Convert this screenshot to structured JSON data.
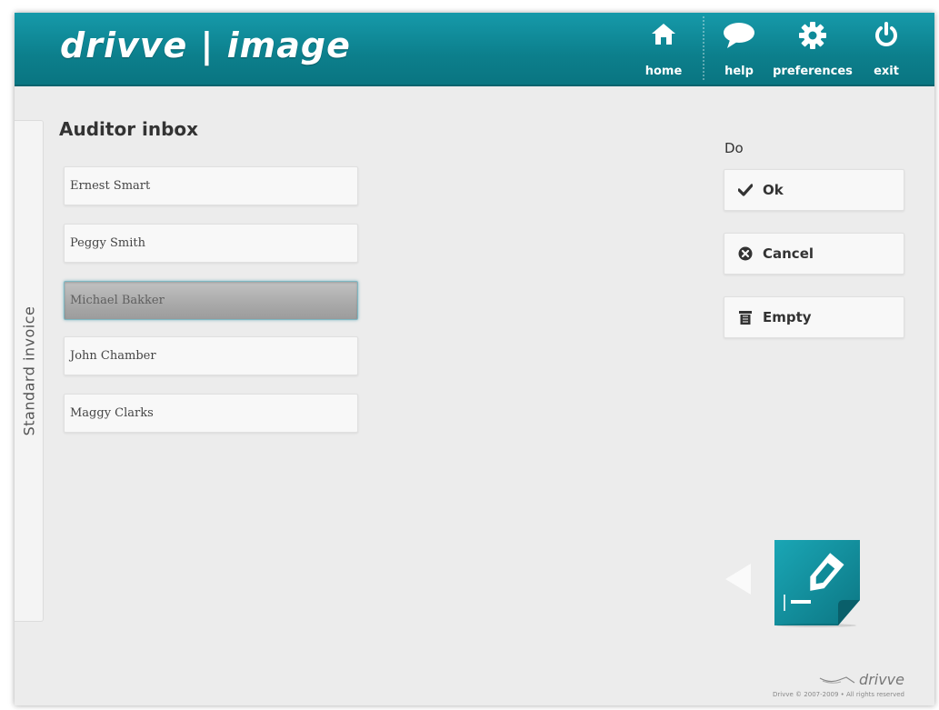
{
  "header": {
    "logo": "drivve | image",
    "nav": [
      {
        "label": "home",
        "icon": "home-icon"
      },
      {
        "label": "help",
        "icon": "speech-bubble-icon"
      },
      {
        "label": "preferences",
        "icon": "gear-icon"
      },
      {
        "label": "exit",
        "icon": "power-icon"
      }
    ]
  },
  "sidebar": {
    "tab_label": "Standard invoice"
  },
  "inbox": {
    "title": "Auditor inbox",
    "items": [
      {
        "name": "Ernest Smart",
        "selected": false
      },
      {
        "name": "Peggy Smith",
        "selected": false
      },
      {
        "name": "Michael Bakker",
        "selected": true
      },
      {
        "name": "John Chamber",
        "selected": false
      },
      {
        "name": "Maggy Clarks",
        "selected": false
      }
    ]
  },
  "actions": {
    "label": "Do",
    "buttons": [
      {
        "label": "Ok",
        "icon": "checkmark-icon"
      },
      {
        "label": "Cancel",
        "icon": "cancel-circle-icon"
      },
      {
        "label": "Empty",
        "icon": "trash-icon"
      }
    ]
  },
  "footer": {
    "logo": "drivve",
    "copyright": "Drivve © 2007-2009 • All rights reserved"
  },
  "colors": {
    "brand_teal": "#0f8a98",
    "background": "#ececec",
    "selected_item": "#a9a9a9"
  }
}
